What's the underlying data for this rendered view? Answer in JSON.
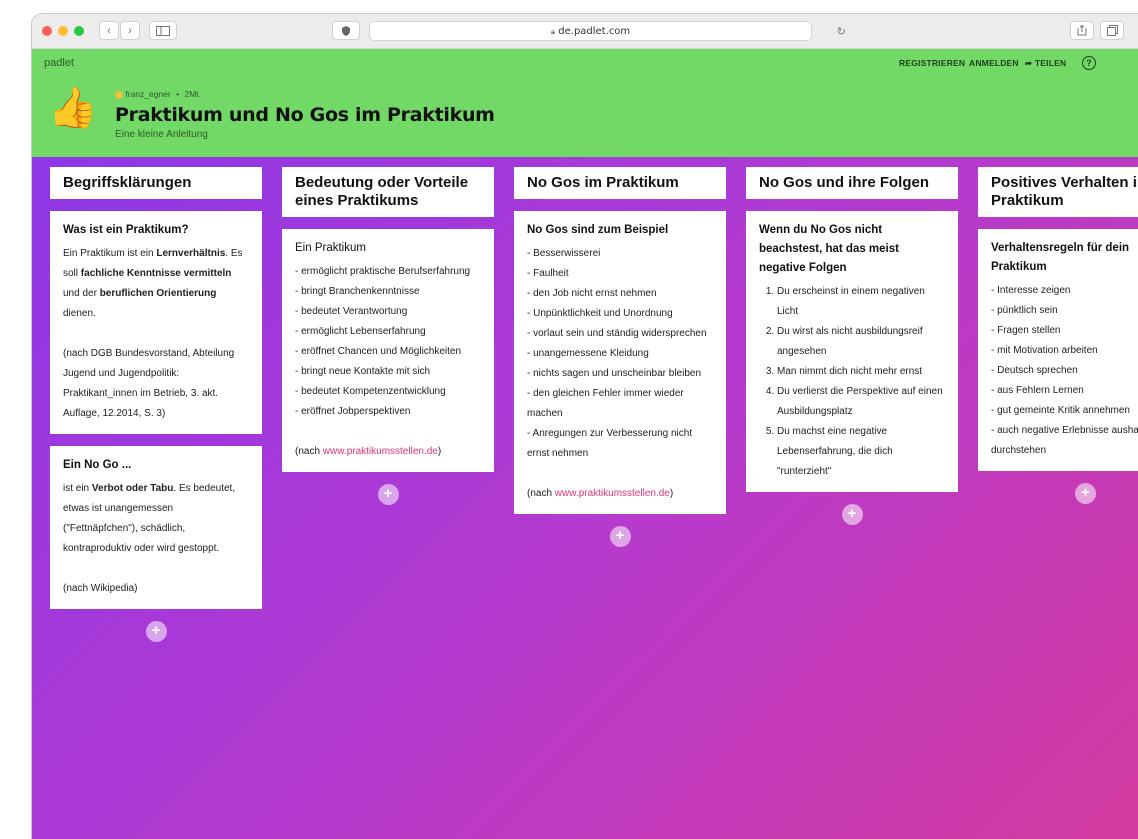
{
  "browser": {
    "url": "de.padlet.com",
    "back_label": "‹",
    "forward_label": "›"
  },
  "header": {
    "logo": "padlet",
    "nav": {
      "register": "REGISTRIEREN",
      "login": "ANMELDEN",
      "share": "TEILEN",
      "help": "?"
    },
    "author": "franz_egner",
    "age": "2Mt.",
    "title": "Praktikum und No Gos im Praktikum",
    "subtitle": "Eine kleine Anleitung",
    "emoji": "👍"
  },
  "columns": [
    {
      "title": "Begriffsklärungen",
      "cards": [
        {
          "title": "Was ist ein Praktikum?",
          "p1": [
            "Ein Praktikum ist ein ",
            "Lernverhältnis",
            ". Es soll ",
            "fachliche Kenntnisse vermitteln",
            " und der ",
            "beruflichen Orientierung",
            " dienen."
          ],
          "source": "(nach DGB Bundesvorstand, Abteilung Jugend und Jugendpolitik: Praktikant_innen im Betrieb, 3. akt. Auflage, 12.2014, S. 3)"
        },
        {
          "title": "Ein No Go ...",
          "p1": [
            "ist ein ",
            "Verbot oder Tabu",
            ". Es bedeutet, etwas ist unangemessen (\"Fettnäpfchen\"), schädlich, kontraproduktiv oder wird gestoppt."
          ],
          "source": "(nach Wikipedia)"
        }
      ]
    },
    {
      "title": "Bedeutung oder Vorteile eines Praktikums",
      "cards": [
        {
          "title": "Ein Praktikum",
          "items": [
            "- ermöglicht praktische Berufserfahrung",
            "- bringt Branchenkenntnisse",
            "- bedeutet Verantwortung",
            "- ermöglicht Lebenserfahrung",
            "- eröffnet Chancen und Möglichkeiten",
            "- bringt neue Kontakte mit sich",
            "- bedeutet Kompetenzentwicklung",
            "- eröffnet Jobperspektiven"
          ],
          "source_prefix": "(nach ",
          "source_link": "www.praktikumsstellen.de",
          "source_suffix": ")"
        }
      ]
    },
    {
      "title": "No Gos im Praktikum",
      "cards": [
        {
          "title": "No Gos sind zum Beispiel",
          "items": [
            "- Besserwisserei",
            "- Faulheit",
            "- den Job nicht ernst nehmen",
            "- Unpünktlichkeit und Unordnung",
            "- vorlaut sein und ständig widersprechen",
            "- unangemessene Kleidung",
            "- nichts sagen und unscheinbar bleiben",
            "- den gleichen Fehler immer wieder machen",
            "- Anregungen zur Verbesserung nicht ernst nehmen"
          ],
          "source_prefix": "(nach ",
          "source_link": "www.praktikumsstellen.de",
          "source_suffix": ")"
        }
      ]
    },
    {
      "title": "No Gos und ihre Folgen",
      "cards": [
        {
          "title": "Wenn du No Gos nicht beachstest, hat das meist negative Folgen",
          "items": [
            "Du erscheinst in einem negativen Licht",
            "Du wirst als nicht ausbildungsreif angesehen",
            "Man nimmt dich nicht mehr ernst",
            "Du verlierst die Perspektive auf einen Ausbildungsplatz",
            "Du machst eine negative Lebenserfahrung, die dich \"runterzieht\""
          ]
        }
      ]
    },
    {
      "title": "Positives Verhalten im Praktikum",
      "cards": [
        {
          "title": "Verhaltensregeln für dein Praktikum",
          "items": [
            "- Interesse zeigen",
            "- pünktlich sein",
            "- Fragen stellen",
            "- mit Motivation arbeiten",
            "- Deutsch sprechen",
            "- aus Fehlern Lernen",
            "- gut gemeinte Kritik annehmen",
            "- auch negative Erlebnisse aushalten und durchstehen"
          ]
        }
      ]
    }
  ],
  "add_post_label": "+",
  "colors": {
    "header_green": "#72d866",
    "board_start": "#8e37e6",
    "board_end": "#d33a9e",
    "link_pink": "#e0337f"
  }
}
